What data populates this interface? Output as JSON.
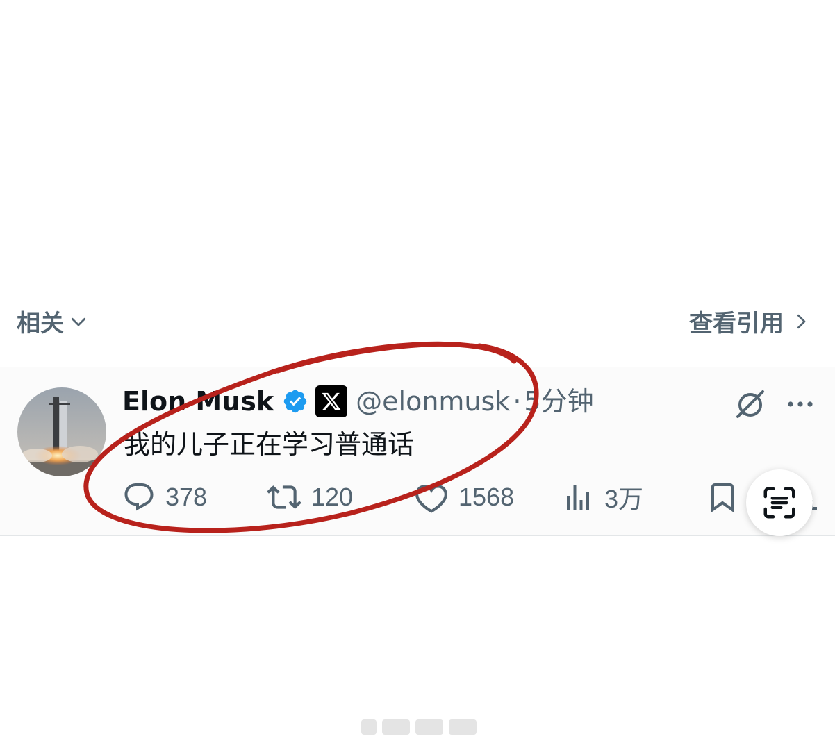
{
  "section": {
    "related_label": "相关",
    "quotes_link": "查看引用"
  },
  "tweet": {
    "author_name": "Elon Musk",
    "handle": "@elonmusk",
    "separator": "·",
    "time": "5分钟",
    "text": "我的儿子正在学习普通话",
    "actions": {
      "replies": "378",
      "retweets": "120",
      "likes": "1568",
      "views": "3万"
    }
  },
  "colors": {
    "secondary_text": "#536471",
    "verified_blue": "#1d9bf0",
    "annotation_red": "#b8221c"
  },
  "icons": {
    "related": "chevron-down-icon",
    "quotes": "chevron-right-icon",
    "verified": "verified-badge-icon",
    "affiliation": "x-logo-icon",
    "grok": "grok-icon",
    "more": "more-dots-icon",
    "reply": "reply-bubble-icon",
    "retweet": "retweet-icon",
    "like": "heart-icon",
    "views": "bar-chart-icon",
    "bookmark": "bookmark-icon",
    "scan": "scan-text-icon"
  }
}
